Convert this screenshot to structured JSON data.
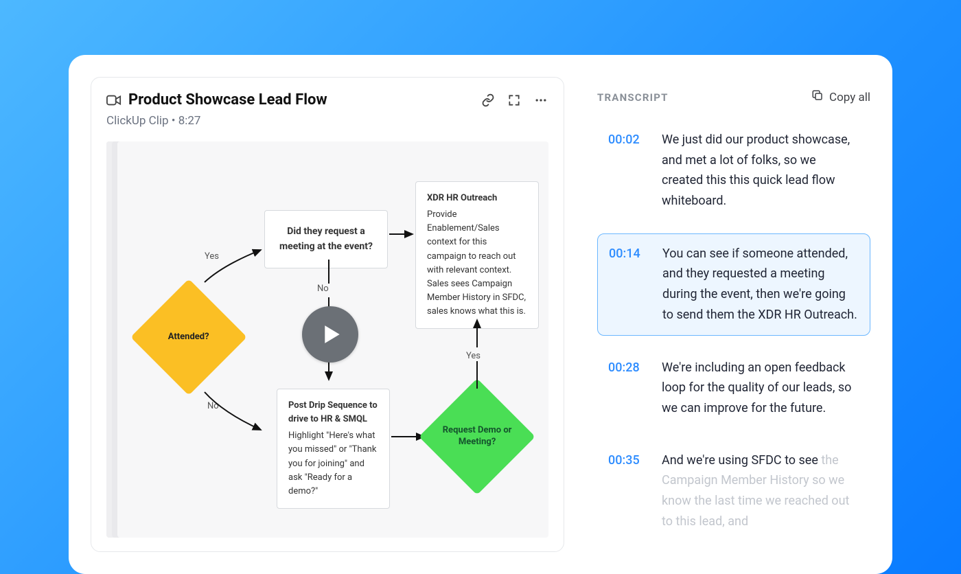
{
  "clip": {
    "title": "Product Showcase Lead Flow",
    "source": "ClickUp Clip",
    "duration": "8:27"
  },
  "flow": {
    "attended_label": "Attended?",
    "yes_label": "Yes",
    "no_label": "No",
    "request_meeting_label": "Did they request a meeting at the event?",
    "xdr_title": "XDR HR Outreach",
    "xdr_body": "Provide Enablement/Sales context for this campaign to reach out with relevant context. Sales sees Campaign Member History in SFDC, sales knows what this is.",
    "postdrip_title": "Post Drip Sequence to drive to HR & SMQL",
    "postdrip_body": "Highlight \"Here's what you missed\" or \"Thank you for joining\" and ask \"Ready for a demo?\"",
    "request_demo_label": "Request Demo or Meeting?"
  },
  "transcript": {
    "heading": "TRANSCRIPT",
    "copy_all_label": "Copy all",
    "entries": [
      {
        "ts": "00:02",
        "text": "We just did our product showcase, and met a lot of folks, so we created this this quick lead flow whiteboard."
      },
      {
        "ts": "00:14",
        "text": "You can see if someone attended, and they requested a meeting during the event, then we're going to send them the XDR HR Outreach."
      },
      {
        "ts": "00:28",
        "text": "We're including an open feedback loop for the quality of our leads, so we can improve for the future."
      },
      {
        "ts": "00:35",
        "lead": "And we're using SFDC to see ",
        "rest": "the Campaign Member History so we know the last time we reached out to this lead, and"
      }
    ]
  }
}
